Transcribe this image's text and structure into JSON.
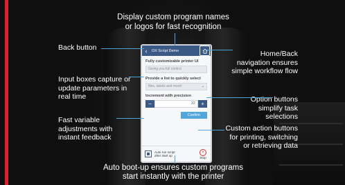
{
  "screen": {
    "title": "OX Script Demo",
    "field1_label": "Fully customizable printer UI",
    "field1_value": "Giving you full control",
    "field2_label": "Provide a list to quickly select",
    "field2_value": "files, labels and more!",
    "field3_label": "Increment with precision",
    "stepper_minus": "−",
    "stepper_plus": "+",
    "stepper_value": "32",
    "confirm_label": "Confirm",
    "autorun_label": "Auto run script after start up",
    "stop_label": "Stop"
  },
  "annotations": {
    "top_1": "Display custom program names",
    "top_2": "or logos for fast recognition",
    "back": "Back button",
    "home_1": "Home/Back",
    "home_2": "navigation ensures",
    "home_3": "simple workflow flow",
    "input_1": "Input boxes capture or",
    "input_2": "update parameters in",
    "input_3": "real time",
    "option_1": "Option buttons",
    "option_2": "simplify task",
    "option_3": "selections",
    "variable_1": "Fast variable",
    "variable_2": "adjustments with",
    "variable_3": "instant feedback",
    "custom_1": "Custom action buttons",
    "custom_2": "for printing, switching",
    "custom_3": "or retrieving data",
    "boot_1": "Auto boot-up ensures custom programs",
    "boot_2": "start instantly with the printer"
  },
  "colors": {
    "accent_red": "#e0202a",
    "callout_blue": "#4fa3d8",
    "screen_header": "#3a5a85",
    "confirm_button": "#53a7dc"
  },
  "icons": {
    "back": "chevron-left-icon",
    "home": "home-icon",
    "dropdown": "chevron-down-icon",
    "stop": "stop-icon",
    "checkbox": "checkbox-icon"
  }
}
